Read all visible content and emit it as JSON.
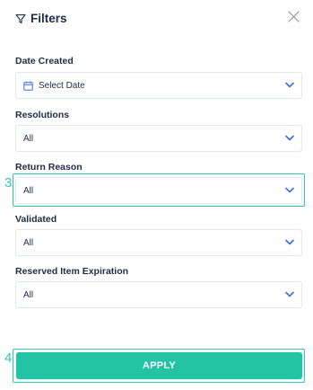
{
  "header": {
    "title": "Filters",
    "icon": "filter-icon",
    "close_icon": "close-icon"
  },
  "filters": [
    {
      "label": "Date Created",
      "value": "Select Date",
      "icon": "calendar-icon"
    },
    {
      "label": "Resolutions",
      "value": "All"
    },
    {
      "label": "Return Reason",
      "value": "All"
    },
    {
      "label": "Validated",
      "value": "All"
    },
    {
      "label": "Reserved Item Expiration",
      "value": "All"
    }
  ],
  "annotations": {
    "marker_3": "3",
    "marker_4": "4"
  },
  "apply_label": "APPLY",
  "colors": {
    "accent": "#22c4a5",
    "chevron": "#3b6fd6",
    "highlight": "#2ec9ad",
    "text": "#1f2a44"
  }
}
